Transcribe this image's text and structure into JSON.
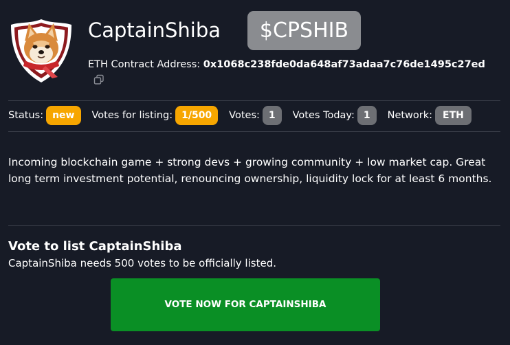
{
  "token": {
    "name": "CaptainShiba",
    "ticker": "$CPSHIB",
    "logo_icon": "shiba-shield-logo"
  },
  "contract": {
    "label": "ETH Contract Address:",
    "address": "0x1068c238fde0da648af73adaa7c76de1495c27ed",
    "copy_icon": "copy-icon"
  },
  "stats": {
    "status_label": "Status:",
    "status_value": "new",
    "listing_label": "Votes for listing:",
    "listing_value": "1/500",
    "votes_label": "Votes:",
    "votes_value": "1",
    "today_label": "Votes Today:",
    "today_value": "1",
    "network_label": "Network:",
    "network_value": "ETH"
  },
  "description": "Incoming blockchain game + strong devs + growing community + low market cap. Great long term investment potential, renouncing ownership, liquidity lock for at least 6 months.",
  "vote": {
    "heading": "Vote to list CaptainShiba",
    "subtext": "CaptainShiba needs 500 votes to be officially listed.",
    "button_label": "VOTE NOW FOR CAPTAINSHIBA"
  },
  "colors": {
    "background": "#171b26",
    "ticker_badge": "#8a8c90",
    "orange_badge": "#f7a600",
    "gray_badge": "#6d6f74",
    "vote_button": "#0a8f25",
    "divider": "#3b3f4a"
  }
}
